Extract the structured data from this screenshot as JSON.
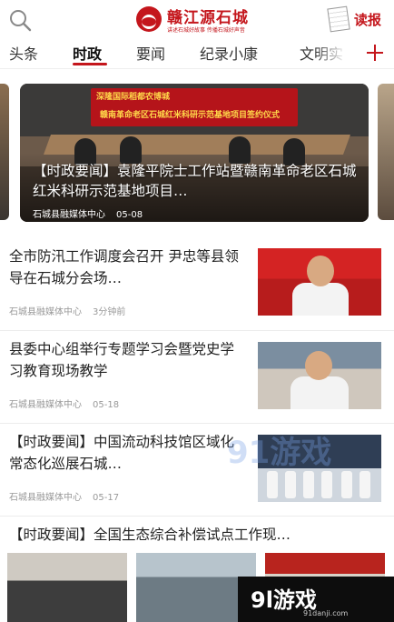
{
  "header": {
    "logo_title": "赣江源石城",
    "logo_slogan": "讲述石城好故事 传播石城好声音",
    "readpaper_label": "读报"
  },
  "tabs": [
    {
      "label": "头条",
      "active": false
    },
    {
      "label": "时政",
      "active": true
    },
    {
      "label": "要闻",
      "active": false
    },
    {
      "label": "纪录小康",
      "active": false
    },
    {
      "label": "文明实",
      "active": false
    }
  ],
  "carousel": {
    "banner_line1": "深隆国际稻都农博城",
    "banner_line2": "赣南革命老区石城红米科研示范基地项目签约仪式",
    "caption": "【时政要闻】袁隆平院士工作站暨赣南革命老区石城红米科研示范基地项目…",
    "source": "石城县融媒体中心",
    "date": "05-08"
  },
  "news": [
    {
      "title": "全市防汛工作调度会召开 尹忠等县领导在石城分会场…",
      "source": "石城县融媒体中心",
      "time": "3分钟前"
    },
    {
      "title": "县委中心组举行专题学习会暨党史学习教育现场教学",
      "source": "石城县融媒体中心",
      "time": "05-18"
    },
    {
      "title": "【时政要闻】中国流动科技馆区域化常态化巡展石城…",
      "source": "石城县融媒体中心",
      "time": "05-17"
    },
    {
      "title": "【时政要闻】全国生态综合补偿试点工作现…"
    }
  ],
  "watermark": {
    "logo": "9l游戏",
    "url": "91danji.com",
    "ghost": "91游戏"
  },
  "colors": {
    "accent": "#c4161c"
  }
}
